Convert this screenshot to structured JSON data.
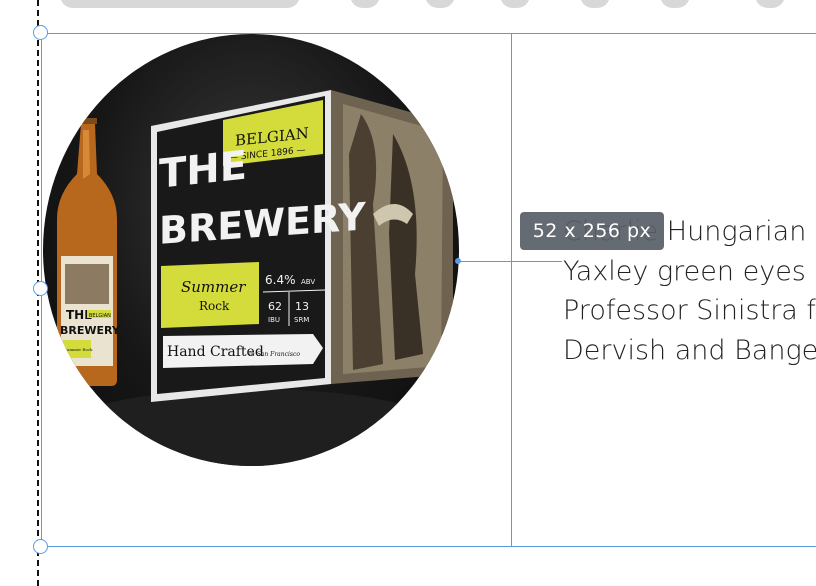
{
  "canvas": {
    "size_tooltip": "52 x 256 px"
  },
  "product_image": {
    "box_title_top": "THE",
    "box_title_main": "BREWERY",
    "belgian_label": "BELGIAN",
    "since_label": "— SINCE 1896 —",
    "beer_name": "Summer",
    "beer_style": "Rock",
    "abv_value": "6.4%",
    "abv_label": "ABV",
    "ibu_value": "62",
    "ibu_label": "IBU",
    "srm_value": "13",
    "srm_label": "SRM",
    "tagline": "Hand Crafted",
    "tagline_sub": "in San Francisco",
    "bottle_title_top": "THE",
    "bottle_title_main": "BREWERY",
    "bottle_belgian": "BELGIAN",
    "bottle_beer": "Summer Rock"
  },
  "text_block": {
    "lines": [
      "Charlie Hungarian",
      "Yaxley green eyes",
      "Professor Sinistra f",
      "Dervish and Bange"
    ]
  },
  "colors": {
    "selection": "#5b9be6",
    "label_yellow": "#d4dc3c"
  }
}
